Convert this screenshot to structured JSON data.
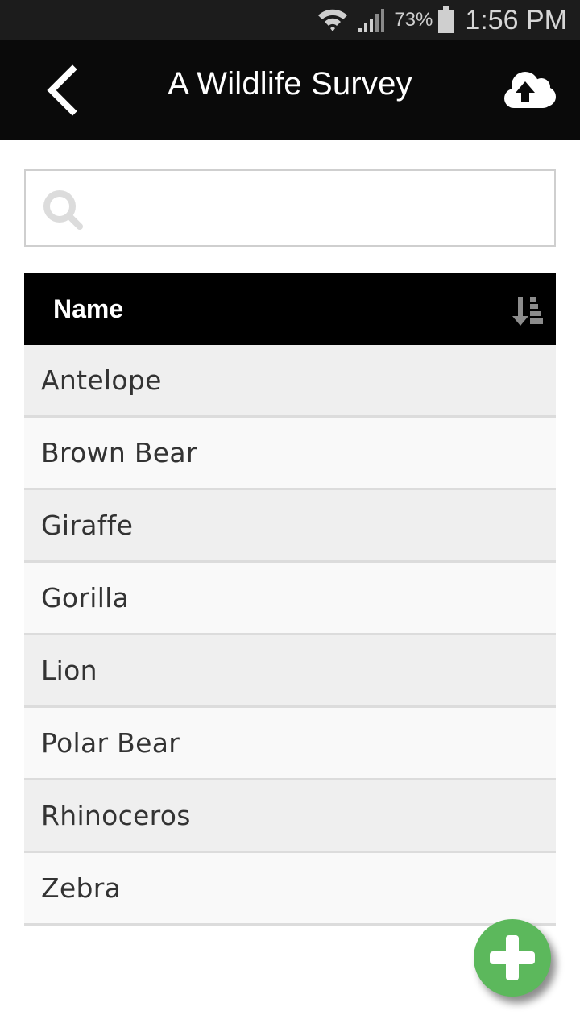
{
  "status_bar": {
    "battery_percent": "73%",
    "time": "1:56 PM",
    "icons": [
      "wifi-icon",
      "signal-icon",
      "battery-icon"
    ]
  },
  "app_bar": {
    "title": "A Wildlife Survey",
    "back_icon": "chevron-left-icon",
    "upload_icon": "cloud-upload-icon"
  },
  "search": {
    "placeholder": "",
    "value": "",
    "icon": "search-icon"
  },
  "table": {
    "header": {
      "name_label": "Name",
      "sort_icon": "sort-descending-icon"
    },
    "rows": [
      {
        "name": "Antelope"
      },
      {
        "name": "Brown Bear"
      },
      {
        "name": "Giraffe"
      },
      {
        "name": "Gorilla"
      },
      {
        "name": "Lion"
      },
      {
        "name": "Polar Bear"
      },
      {
        "name": "Rhinoceros"
      },
      {
        "name": "Zebra"
      }
    ]
  },
  "fab": {
    "icon": "plus-icon",
    "color": "#5cb85c"
  },
  "colors": {
    "app_bar": "#0a0a0a",
    "status_bar": "#1c1c1c",
    "header": "#000000",
    "row_odd": "#efefef",
    "row_even": "#f9f9f9"
  }
}
